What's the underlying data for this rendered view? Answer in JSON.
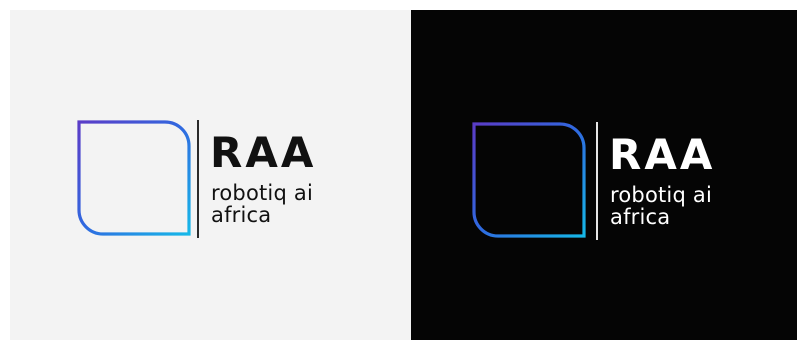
{
  "logo": {
    "abbreviation": "RAA",
    "tagline_line1": "robotiq ai",
    "tagline_line2": "africa",
    "emblem_icon": "africa-map-in-rounded-frame-icon",
    "gradient_colors": [
      "#5a3cc7",
      "#2f6ae0",
      "#16b8e8"
    ]
  },
  "variants": [
    {
      "name": "light",
      "background": "#f3f3f3",
      "text_color": "#111111"
    },
    {
      "name": "dark",
      "background": "#050505",
      "text_color": "#ffffff"
    }
  ]
}
